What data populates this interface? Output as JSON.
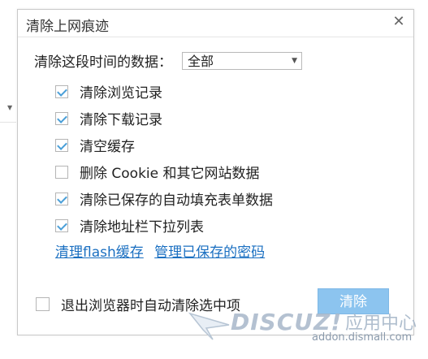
{
  "dialog": {
    "title": "清除上网痕迹",
    "close_glyph": "✕"
  },
  "range": {
    "label": "清除这段时间的数据：",
    "selected": "全部",
    "arrow_glyph": "▼"
  },
  "options": [
    {
      "label": "清除浏览记录",
      "checked": true
    },
    {
      "label": "清除下载记录",
      "checked": true
    },
    {
      "label": "清空缓存",
      "checked": true
    },
    {
      "label": "删除 Cookie 和其它网站数据",
      "checked": false
    },
    {
      "label": "清除已保存的自动填充表单数据",
      "checked": true
    },
    {
      "label": "清除地址栏下拉列表",
      "checked": true
    }
  ],
  "links": {
    "flash": "清理flash缓存",
    "passwords": "管理已保存的密码"
  },
  "footer": {
    "auto_clear_label": "退出浏览器时自动清除选中项",
    "auto_clear_checked": false,
    "clear_button": "清除"
  },
  "watermark": {
    "brand": "DISCUZ!",
    "sub": "应用中心",
    "url": "addon.dismall.com"
  },
  "colors": {
    "accent": "#4a9fd8",
    "link": "#1a6fc1",
    "button": "#8cc4ef"
  }
}
